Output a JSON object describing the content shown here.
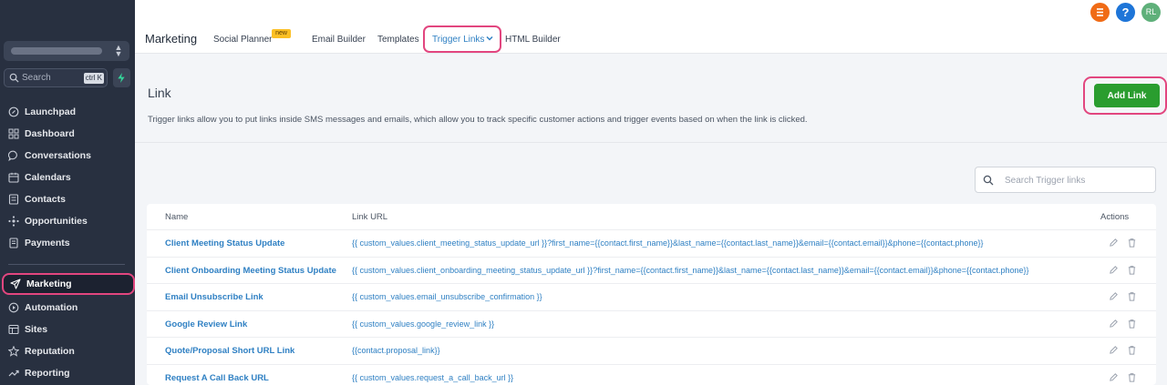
{
  "sidebar": {
    "search_placeholder": "Search",
    "search_shortcut": "ctrl K",
    "items": [
      {
        "label": "Launchpad",
        "icon": "launchpad-icon"
      },
      {
        "label": "Dashboard",
        "icon": "dashboard-icon"
      },
      {
        "label": "Conversations",
        "icon": "chat-icon"
      },
      {
        "label": "Calendars",
        "icon": "calendar-icon"
      },
      {
        "label": "Contacts",
        "icon": "contacts-icon"
      },
      {
        "label": "Opportunities",
        "icon": "opportunities-icon"
      },
      {
        "label": "Payments",
        "icon": "payments-icon"
      },
      {
        "label": "Marketing",
        "icon": "send-icon",
        "active": true
      },
      {
        "label": "Automation",
        "icon": "automation-icon"
      },
      {
        "label": "Sites",
        "icon": "sites-icon"
      },
      {
        "label": "Reputation",
        "icon": "star-icon"
      },
      {
        "label": "Reporting",
        "icon": "reporting-icon"
      }
    ]
  },
  "header": {
    "title": "Marketing",
    "tabs": {
      "social": "Social Planner",
      "social_badge": "new",
      "email": "Email Builder",
      "templates": "Templates",
      "trigger": "Trigger Links",
      "html": "HTML Builder"
    },
    "help": "?",
    "user_initials": "RL"
  },
  "page": {
    "title": "Link",
    "description": "Trigger links allow you to put links inside SMS messages and emails, which allow you to track specific customer actions and trigger events based on when the link is clicked.",
    "add_button": "Add Link",
    "search_placeholder": "Search Trigger links"
  },
  "table": {
    "headers": {
      "name": "Name",
      "url": "Link URL",
      "actions": "Actions"
    },
    "rows": [
      {
        "name": "Client Meeting Status Update",
        "url": "{{ custom_values.client_meeting_status_update_url }}?first_name={{contact.first_name}}&last_name={{contact.last_name}}&email={{contact.email}}&phone={{contact.phone}}"
      },
      {
        "name": "Client Onboarding Meeting Status Update",
        "url": "{{ custom_values.client_onboarding_meeting_status_update_url }}?first_name={{contact.first_name}}&last_name={{contact.last_name}}&email={{contact.email}}&phone={{contact.phone}}"
      },
      {
        "name": "Email Unsubscribe Link",
        "url": "{{ custom_values.email_unsubscribe_confirmation }}"
      },
      {
        "name": "Google Review Link",
        "url": "{{ custom_values.google_review_link }}"
      },
      {
        "name": "Quote/Proposal Short URL Link",
        "url": "{{contact.proposal_link}}"
      },
      {
        "name": "Request A Call Back URL",
        "url": "{{ custom_values.request_a_call_back_url }}"
      }
    ]
  },
  "colors": {
    "sidebar_bg": "#283040",
    "accent_blue": "#2f80c3",
    "highlight_pink": "#e2467f",
    "add_green": "#2a9d2f"
  }
}
